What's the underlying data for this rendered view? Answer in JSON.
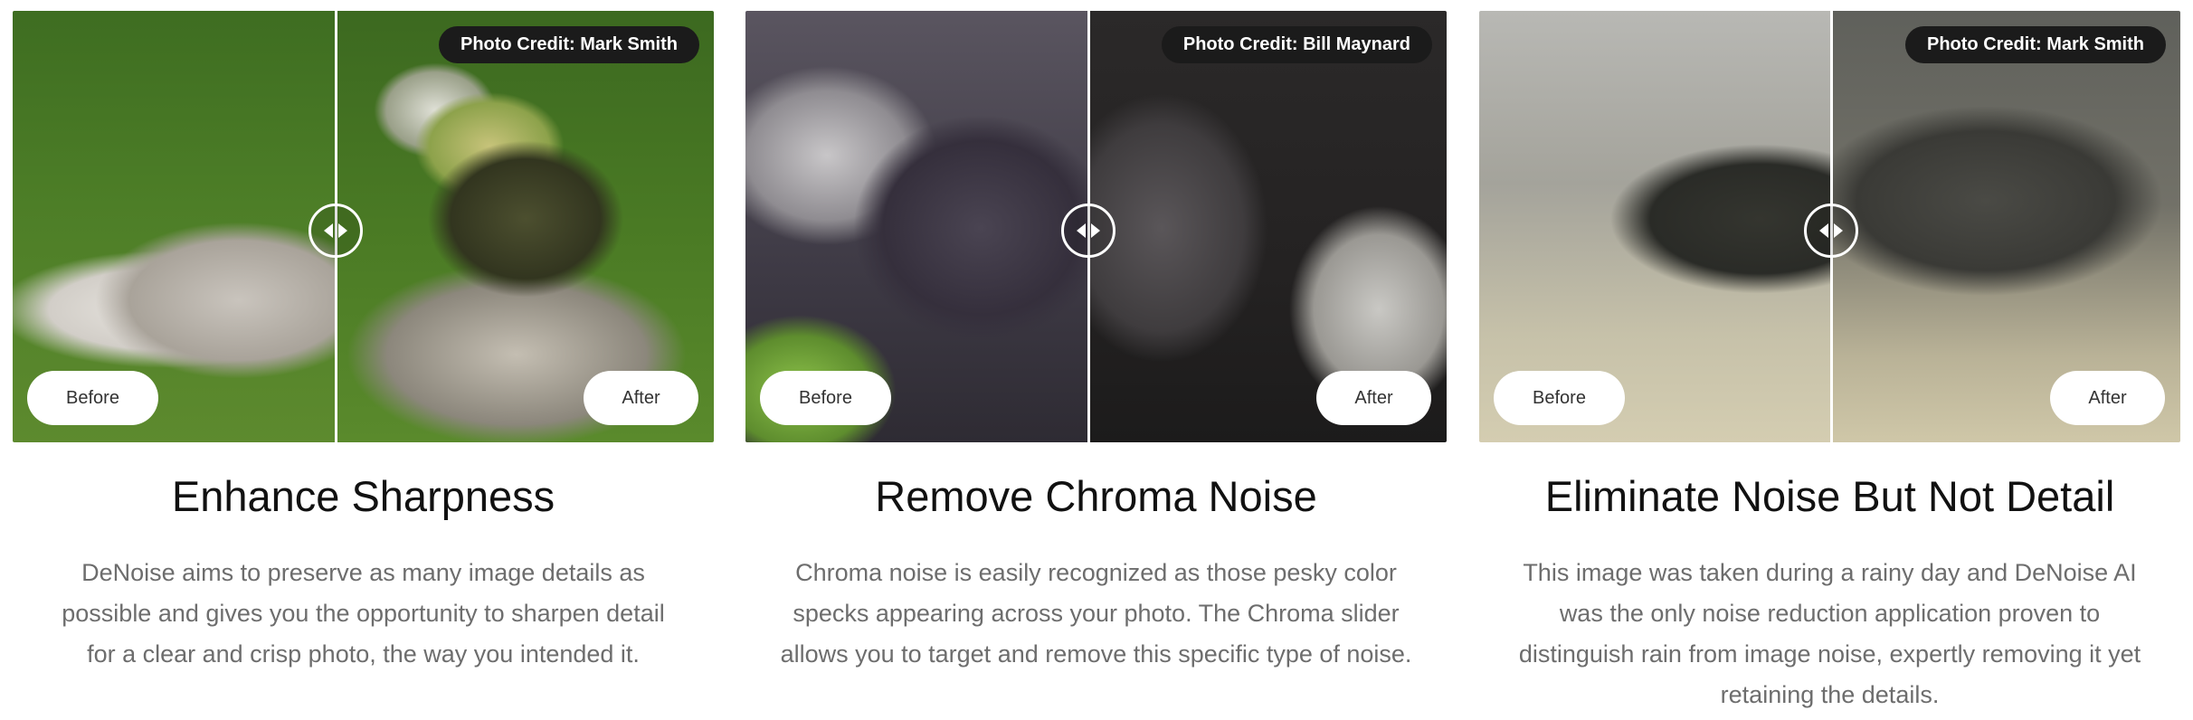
{
  "cards": [
    {
      "photo_credit": "Photo Credit: Mark Smith",
      "before_label": "Before",
      "after_label": "After",
      "title": "Enhance Sharpness",
      "description": "DeNoise aims to preserve as many image details as possible and gives you the opportunity to sharpen detail for a clear and crisp photo, the way you intended it."
    },
    {
      "photo_credit": "Photo Credit: Bill Maynard",
      "before_label": "Before",
      "after_label": "After",
      "title": "Remove Chroma Noise",
      "description": "Chroma noise is easily recognized as those pesky color specks appearing across your photo. The Chroma slider allows you to target and remove this specific type of noise."
    },
    {
      "photo_credit": "Photo Credit: Mark Smith",
      "before_label": "Before",
      "after_label": "After",
      "title": "Eliminate Noise But Not Detail",
      "description": "This image was taken during a rainy day and DeNoise AI was the only noise reduction application proven to distinguish rain from image noise, expertly removing it yet retaining the details."
    }
  ],
  "icons": {
    "slider_handle": "left-right-arrows-icon"
  }
}
